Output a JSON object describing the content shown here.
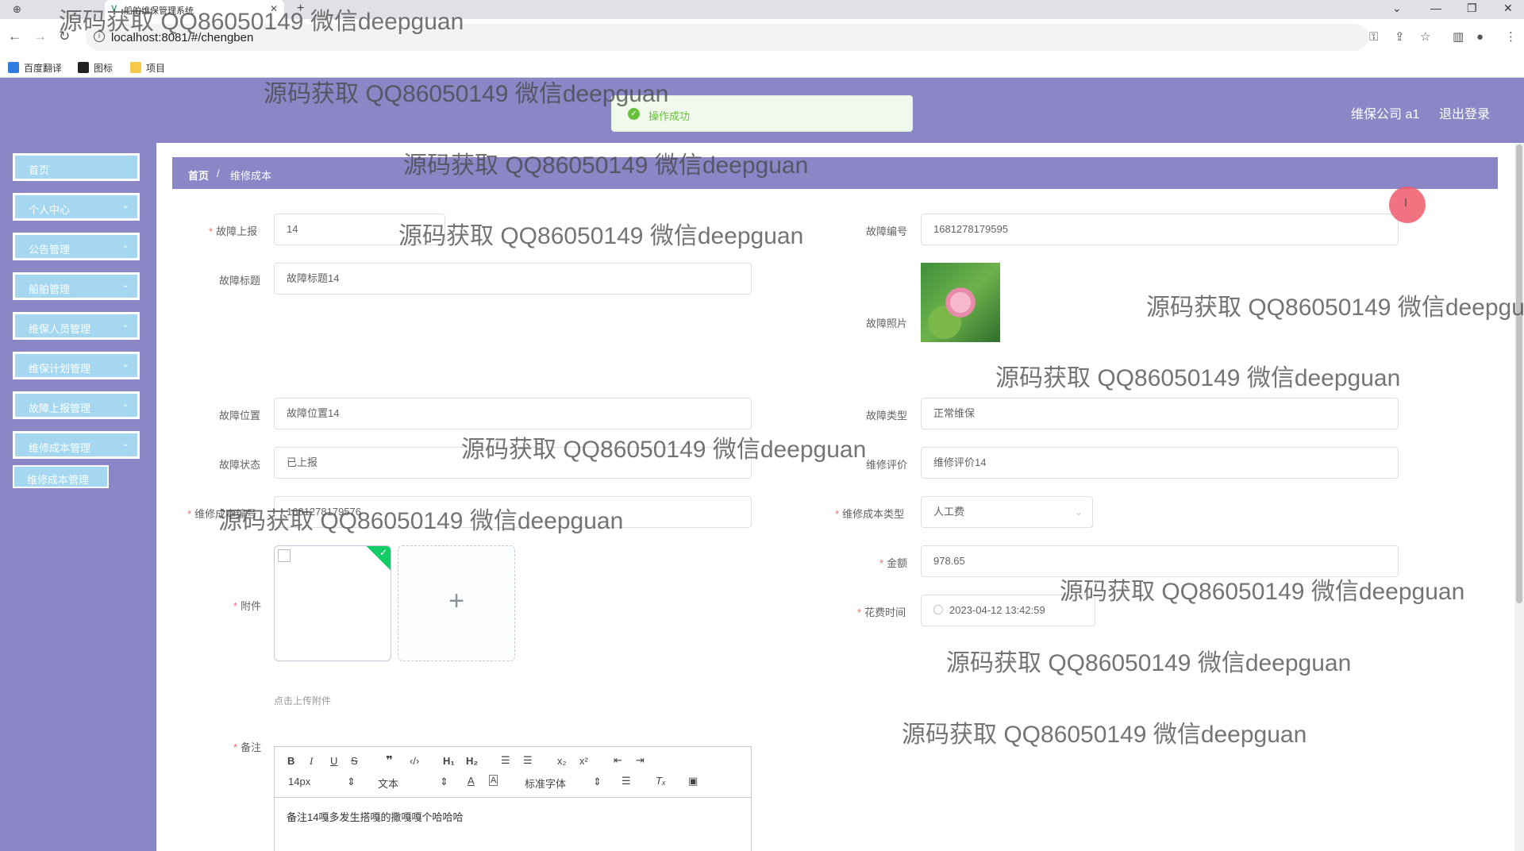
{
  "browser": {
    "tab_title": "船舶维保管理系统",
    "url": "localhost:8081/#/chengben",
    "bookmarks": [
      "百度翻译",
      "图标",
      "项目"
    ]
  },
  "header": {
    "company": "维保公司 a1",
    "logout": "退出登录"
  },
  "toast": {
    "message": "操作成功"
  },
  "sidebar": {
    "items": [
      {
        "label": "首页",
        "chevron": ""
      },
      {
        "label": "个人中心",
        "chevron": "⌄"
      },
      {
        "label": "公告管理",
        "chevron": "⌄"
      },
      {
        "label": "船舶管理",
        "chevron": "⌄"
      },
      {
        "label": "维保人员管理",
        "chevron": "⌄"
      },
      {
        "label": "维保计划管理",
        "chevron": "⌄"
      },
      {
        "label": "故障上报管理",
        "chevron": "⌄"
      },
      {
        "label": "维修成本管理",
        "chevron": "⌄"
      }
    ],
    "sub_item": "维修成本管理"
  },
  "breadcrumb": {
    "home": "首页",
    "separator": "/",
    "current": "维修成本"
  },
  "form": {
    "report_label": "故障上报",
    "report_value": "14",
    "code_label": "故障编号",
    "code_value": "1681278179595",
    "title_label": "故障标题",
    "title_value": "故障标题14",
    "photo_label": "故障照片",
    "location_label": "故障位置",
    "location_value": "故障位置14",
    "type_label": "故障类型",
    "type_value": "正常维保",
    "status_label": "故障状态",
    "status_value": "已上报",
    "eval_label": "维修评价",
    "eval_value": "维修评价14",
    "cost_code_label": "维修成本编号",
    "cost_code_value": "1681278179576",
    "cost_type_label": "维修成本类型",
    "cost_type_value": "人工费",
    "amount_label": "金额",
    "amount_value": "978.65",
    "attach_label": "附件",
    "attach_tip": "点击上传附件",
    "time_label": "花费时间",
    "time_value": "2023-04-12 13:42:59",
    "note_label": "备注",
    "note_value": "备注14嘎多发生搭嘎的撒嘎嘎个哈哈哈"
  },
  "editor": {
    "font_size": "14px",
    "format": "文本",
    "font_family": "标准字体"
  },
  "watermark": "源码获取 QQ86050149 微信deepguan"
}
